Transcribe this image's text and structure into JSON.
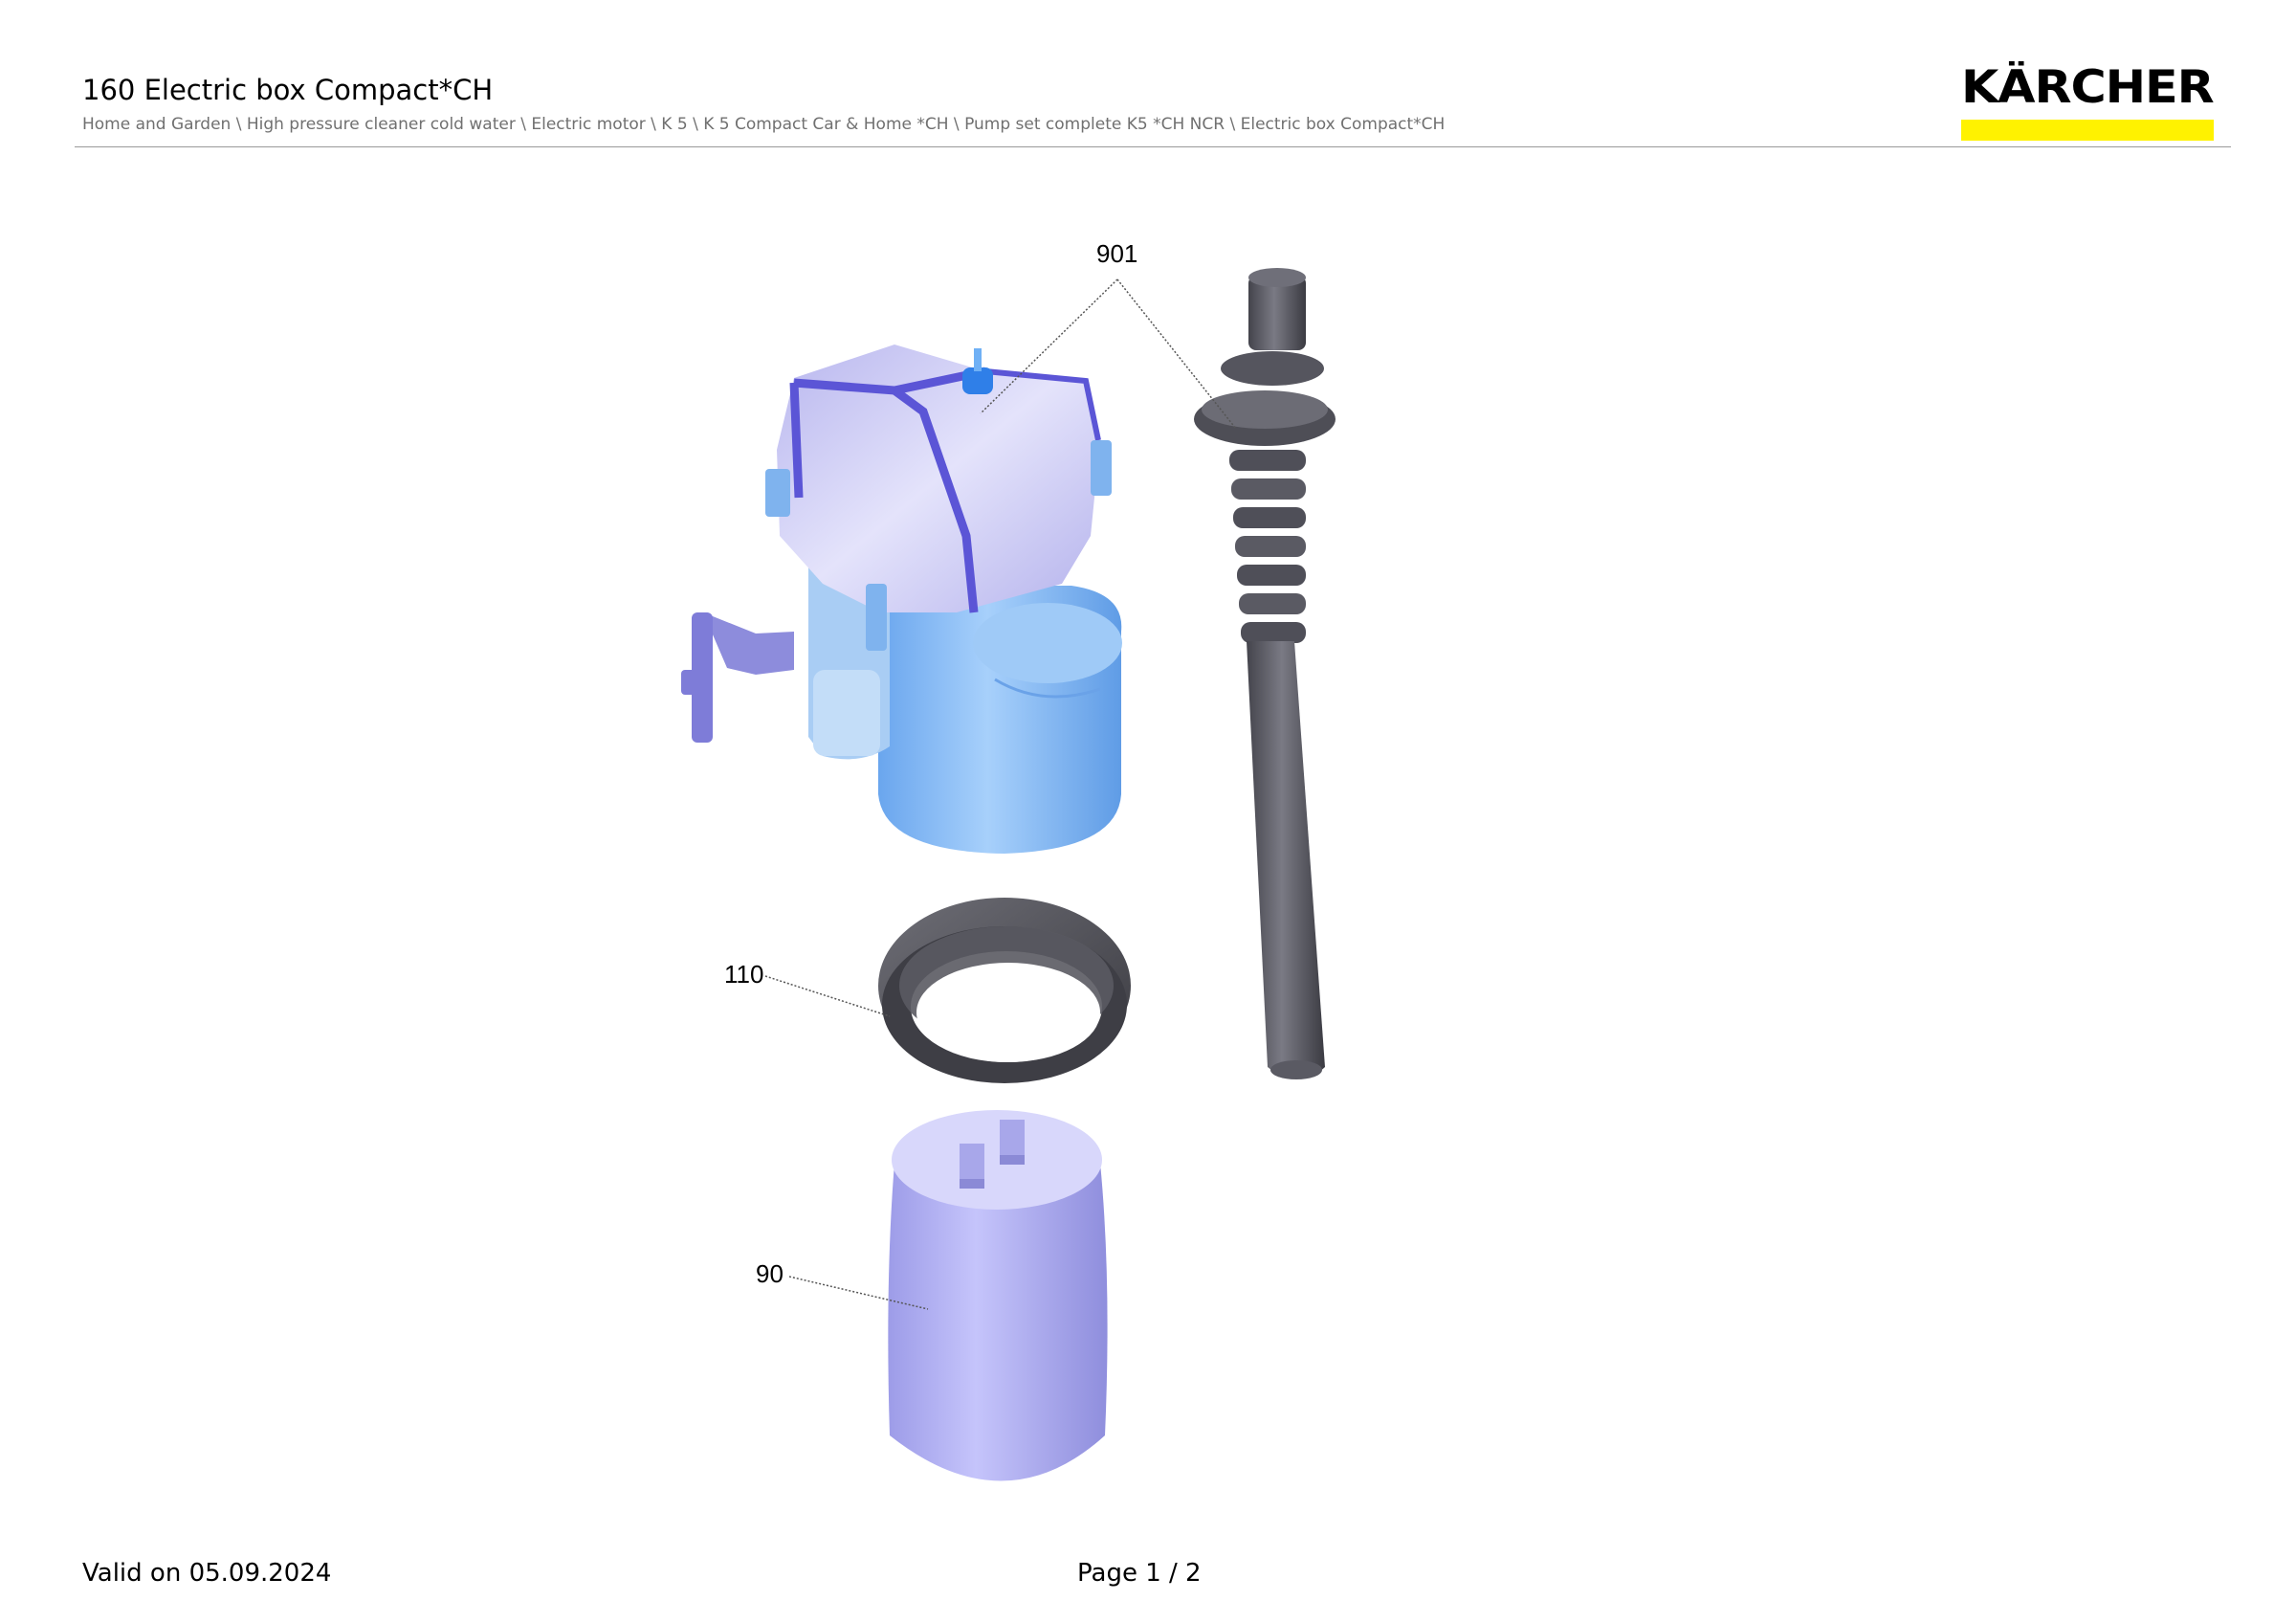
{
  "header": {
    "title": "160 Electric box Compact*CH",
    "breadcrumb": "Home and Garden \\ High pressure cleaner cold water \\ Electric motor \\ K 5 \\ K 5 Compact Car & Home *CH \\ Pump set complete K5 *CH NCR \\ Electric box Compact*CH",
    "brand_logo_text": "KÄRCHER",
    "brand_color": "#fff200"
  },
  "diagram": {
    "callouts": [
      {
        "label": "901",
        "part": "electric-box-housing-and-cable-grommet"
      },
      {
        "label": "110",
        "part": "rubber-seal-ring"
      },
      {
        "label": "90",
        "part": "capacitor"
      }
    ],
    "part_colors": {
      "housing_top": "#c9c8f2",
      "housing_frame": "#5b55d6",
      "housing_body": "#8fc1f5",
      "cable_grommet": "#5c5c66",
      "seal_ring": "#4a4a52",
      "capacitor": "#b7b6f3"
    }
  },
  "footer": {
    "valid": "Valid on 05.09.2024",
    "page": "Page 1 / 2"
  }
}
